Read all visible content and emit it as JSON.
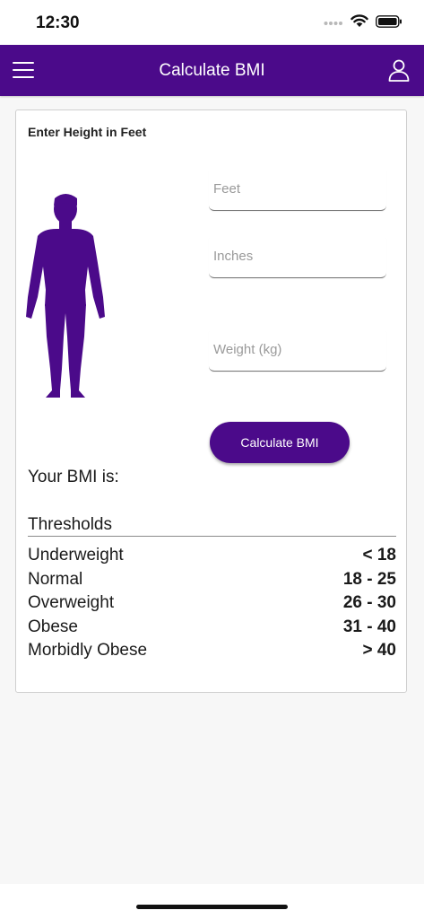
{
  "status_bar": {
    "time": "12:30"
  },
  "nav": {
    "title": "Calculate BMI"
  },
  "form": {
    "heading": "Enter Height in Feet",
    "feet": {
      "value": "",
      "placeholder": "Feet"
    },
    "inches": {
      "value": "",
      "placeholder": "Inches"
    },
    "weight": {
      "value": "",
      "placeholder": "Weight (kg)"
    },
    "calculate_label": "Calculate BMI"
  },
  "result": {
    "label": "Your BMI is:"
  },
  "thresholds": {
    "title": "Thresholds",
    "rows": [
      {
        "category": "Underweight",
        "range": "< 18"
      },
      {
        "category": "Normal",
        "range": "18 - 25"
      },
      {
        "category": "Overweight",
        "range": "26 - 30"
      },
      {
        "category": "Obese",
        "range": "31 - 40"
      },
      {
        "category": "Morbidly Obese",
        "range": "> 40"
      }
    ]
  },
  "icons": {
    "menu": "hamburger-menu-icon",
    "user": "user-icon",
    "figure": "human-body-icon",
    "signal": "cellular-signal-icon",
    "wifi": "wifi-icon",
    "battery": "battery-icon"
  },
  "colors": {
    "brand": "#4b0a8a",
    "background": "#f7f7f7",
    "card": "#ffffff"
  }
}
